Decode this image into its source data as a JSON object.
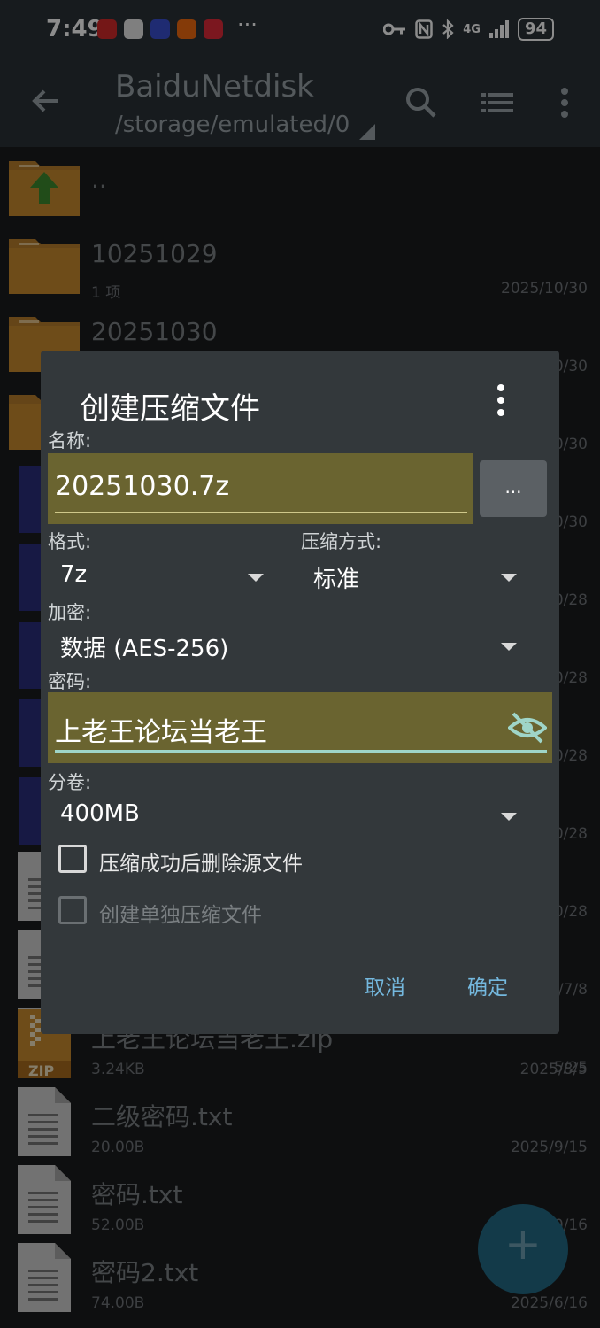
{
  "status": {
    "time": "7:49",
    "more": "···",
    "network": "4G",
    "battery": "94"
  },
  "appbar": {
    "title": "BaiduNetdisk",
    "path": "/storage/emulated/0"
  },
  "files": [
    {
      "name": "..",
      "meta": "",
      "date": "",
      "kind": "parent"
    },
    {
      "name": "10251029",
      "meta": "1 项",
      "date": "2025/10/30",
      "kind": "folder"
    },
    {
      "name": "20251030",
      "meta": "",
      "date": "0/30",
      "kind": "folder"
    },
    {
      "name": "",
      "meta": "",
      "date": "0/30",
      "kind": "folder"
    },
    {
      "name": "",
      "meta": "",
      "date": "0/30",
      "kind": "app"
    },
    {
      "name": "",
      "meta": "",
      "date": "0/28",
      "kind": "app"
    },
    {
      "name": "",
      "meta": "",
      "date": "0/28",
      "kind": "app"
    },
    {
      "name": "",
      "meta": "",
      "date": "0/28",
      "kind": "app"
    },
    {
      "name": "",
      "meta": "",
      "date": "0/28",
      "kind": "app"
    },
    {
      "name": "",
      "meta": "",
      "date": "0/28",
      "kind": "doc"
    },
    {
      "name": "",
      "meta": "",
      "date": "/7/8",
      "kind": "doc"
    },
    {
      "name": "",
      "meta": "",
      "date": "5/25",
      "kind": "doc"
    },
    {
      "name": "上老王论坛当老王.zip",
      "meta": "3.24KB",
      "date": "2025/8/5",
      "kind": "zip"
    },
    {
      "name": "二级密码.txt",
      "meta": "20.00B",
      "date": "2025/9/15",
      "kind": "doc"
    },
    {
      "name": "密码.txt",
      "meta": "52.00B",
      "date": "0/16",
      "kind": "doc"
    },
    {
      "name": "密码2.txt",
      "meta": "74.00B",
      "date": "2025/6/16",
      "kind": "doc"
    }
  ],
  "zip_badge": "ZIP",
  "fab_label": "+",
  "dialog": {
    "title": "创建压缩文件",
    "name_label": "名称:",
    "name_value": "20251030.7z",
    "browse_label": "...",
    "format_label": "格式:",
    "format_value": "7z",
    "method_label": "压缩方式:",
    "method_value": "标准",
    "encrypt_label": "加密:",
    "encrypt_value": "数据 (AES-256)",
    "password_label": "密码:",
    "password_value": "上老王论坛当老王",
    "split_label": "分卷:",
    "split_value": "400MB",
    "delete_source_label": "压缩成功后删除源文件",
    "separate_archives_label": "创建单独压缩文件",
    "cancel_label": "取消",
    "ok_label": "确定"
  },
  "colors": {
    "field_bg": "#6a6430",
    "accent_text": "#74b8de",
    "password_underline": "#9fd5c8",
    "folder": "#c98a2e",
    "app_tile": "#2b2f7c",
    "fab": "#236b85"
  }
}
